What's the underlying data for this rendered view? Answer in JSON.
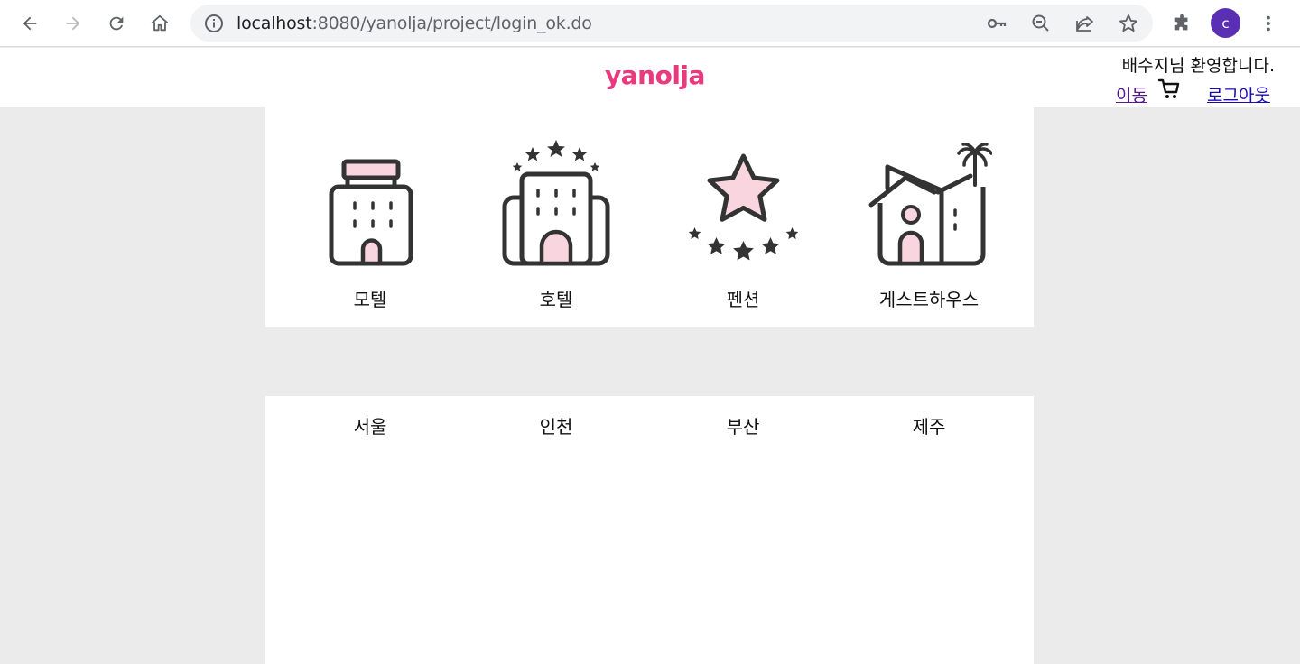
{
  "browser": {
    "url_host": "localhost",
    "url_rest": ":8080/yanolja/project/login_ok.do",
    "profile_initial": "c"
  },
  "header": {
    "logo_text": "yanolja",
    "welcome": "배수지님 환영합니다.",
    "move_link": "이동",
    "logout_link": "로그아웃"
  },
  "categories": [
    {
      "label": "모텔",
      "icon": "motel-icon"
    },
    {
      "label": "호텔",
      "icon": "hotel-icon"
    },
    {
      "label": "펜션",
      "icon": "pension-icon"
    },
    {
      "label": "게스트하우스",
      "icon": "guesthouse-icon"
    }
  ],
  "regions": [
    "서울",
    "인천",
    "부산",
    "제주"
  ],
  "colors": {
    "brand": "#e93a7d",
    "icon_fill": "#f9d5e0",
    "icon_stroke": "#333333",
    "page_bg": "#ebebeb"
  }
}
